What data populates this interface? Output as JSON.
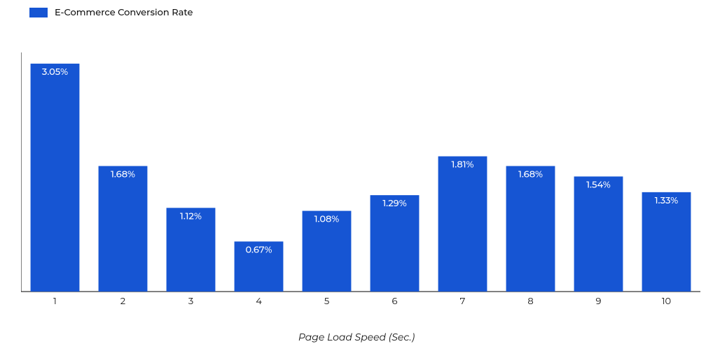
{
  "chart_data": {
    "type": "bar",
    "categories": [
      "1",
      "2",
      "3",
      "4",
      "5",
      "6",
      "7",
      "8",
      "9",
      "10"
    ],
    "values": [
      3.05,
      1.68,
      1.12,
      0.67,
      1.08,
      1.29,
      1.81,
      1.68,
      1.54,
      1.33
    ],
    "value_labels": [
      "3.05%",
      "1.68%",
      "1.12%",
      "0.67%",
      "1.08%",
      "1.29%",
      "1.81%",
      "1.68%",
      "1.54%",
      "1.33%"
    ],
    "title": "",
    "xlabel": "Page Load Speed (Sec.)",
    "ylabel": "",
    "ylim": [
      0,
      3.2
    ],
    "legend": [
      "E-Commerce Conversion Rate"
    ],
    "color": "#1655d3"
  }
}
